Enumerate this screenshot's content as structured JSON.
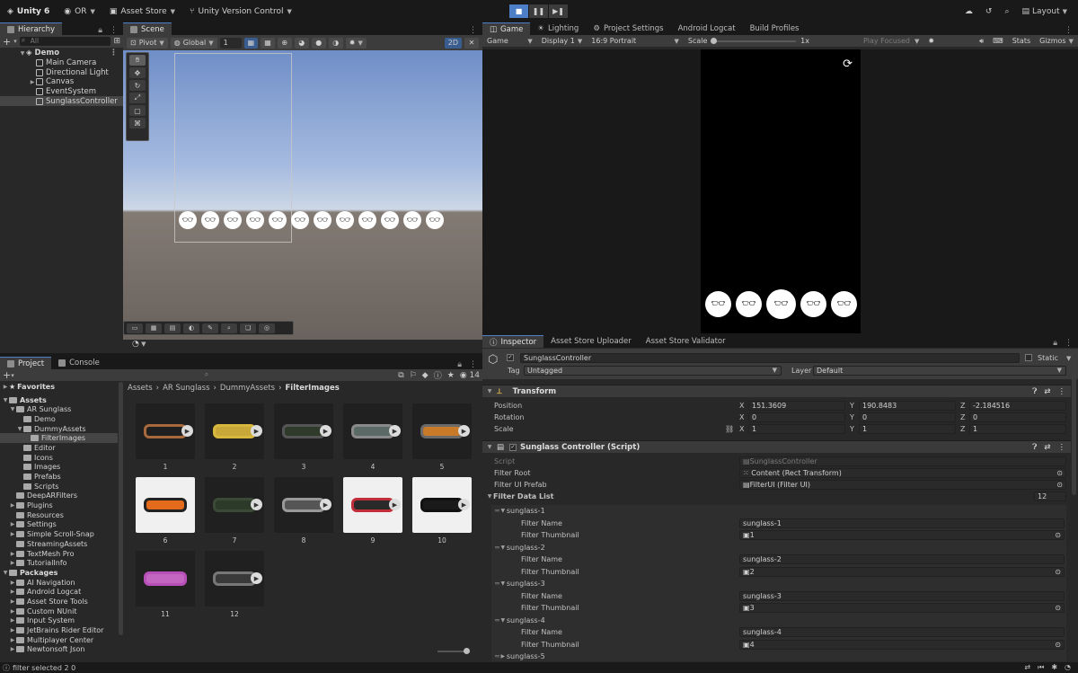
{
  "topbar": {
    "app_name": "Unity 6",
    "account": "OR",
    "asset_store": "Asset Store",
    "version_control": "Unity Version Control",
    "layout": "Layout"
  },
  "hierarchy": {
    "tab": "Hierarchy",
    "search_placeholder": "All",
    "scene_name": "Demo",
    "items": [
      "Main Camera",
      "Directional Light",
      "Canvas",
      "EventSystem",
      "SunglassController"
    ]
  },
  "scene": {
    "tab": "Scene",
    "pivot": "Pivot",
    "global": "Global",
    "grid_value": "1",
    "mode_2d": "2D"
  },
  "game": {
    "tabs": [
      "Game",
      "Lighting",
      "Project Settings",
      "Android Logcat",
      "Build Profiles"
    ],
    "mode": "Game",
    "display": "Display 1",
    "aspect": "16:9 Portrait",
    "scale_label": "Scale",
    "scale_value": "1x",
    "play_focused": "Play Focused",
    "stats": "Stats",
    "gizmos": "Gizmos"
  },
  "project": {
    "tabs": [
      "Project",
      "Console"
    ],
    "hidden_count": "14",
    "favorites": "Favorites",
    "assets_label": "Assets",
    "asset_tree": [
      {
        "label": "AR Sunglass",
        "depth": 1
      },
      {
        "label": "Demo",
        "depth": 2
      },
      {
        "label": "DummyAssets",
        "depth": 2
      },
      {
        "label": "FilterImages",
        "depth": 3
      },
      {
        "label": "Editor",
        "depth": 2
      },
      {
        "label": "Icons",
        "depth": 2
      },
      {
        "label": "Images",
        "depth": 2
      },
      {
        "label": "Prefabs",
        "depth": 2
      },
      {
        "label": "Scripts",
        "depth": 2
      },
      {
        "label": "DeepARFilters",
        "depth": 1
      },
      {
        "label": "Plugins",
        "depth": 1
      },
      {
        "label": "Resources",
        "depth": 1
      },
      {
        "label": "Settings",
        "depth": 1
      },
      {
        "label": "Simple Scroll-Snap",
        "depth": 1
      },
      {
        "label": "StreamingAssets",
        "depth": 1
      },
      {
        "label": "TextMesh Pro",
        "depth": 1
      },
      {
        "label": "TutorialInfo",
        "depth": 1
      }
    ],
    "packages_label": "Packages",
    "packages": [
      "AI Navigation",
      "Android Logcat",
      "Asset Store Tools",
      "Custom NUnit",
      "Input System",
      "JetBrains Rider Editor",
      "Multiplayer Center",
      "Newtonsoft Json"
    ],
    "breadcrumb": [
      "Assets",
      "AR Sunglass",
      "DummyAssets",
      "FilterImages"
    ],
    "assets": [
      "1",
      "2",
      "3",
      "4",
      "5",
      "6",
      "7",
      "8",
      "9",
      "10",
      "11",
      "12"
    ]
  },
  "inspector": {
    "tabs": [
      "Inspector",
      "Asset Store Uploader",
      "Asset Store Validator"
    ],
    "object_name": "SunglassController",
    "static_label": "Static",
    "tag_label": "Tag",
    "tag_value": "Untagged",
    "layer_label": "Layer",
    "layer_value": "Default",
    "transform": {
      "title": "Transform",
      "position_label": "Position",
      "rotation_label": "Rotation",
      "scale_label": "Scale",
      "position": {
        "x": "151.3609",
        "y": "190.8483",
        "z": "-2.184516"
      },
      "rotation": {
        "x": "0",
        "y": "0",
        "z": "0"
      },
      "scale": {
        "x": "1",
        "y": "1",
        "z": "1"
      }
    },
    "script_comp": {
      "title": "Sunglass Controller (Script)",
      "script_label": "Script",
      "script_value": "SunglassController",
      "filter_root_label": "Filter Root",
      "filter_root_value": "Content (Rect Transform)",
      "filter_ui_label": "Filter UI Prefab",
      "filter_ui_value": "FilterUI (Filter UI)",
      "filter_list_label": "Filter Data List",
      "filter_list_count": "12",
      "filter_name_label": "Filter Name",
      "filter_thumb_label": "Filter Thumbnail",
      "filters": [
        {
          "title": "sunglass-1",
          "name": "sunglass-1",
          "thumb": "1"
        },
        {
          "title": "sunglass-2",
          "name": "sunglass-2",
          "thumb": "2"
        },
        {
          "title": "sunglass-3",
          "name": "sunglass-3",
          "thumb": "3"
        },
        {
          "title": "sunglass-4",
          "name": "sunglass-4",
          "thumb": "4"
        }
      ],
      "next_filter": "sunglass-5"
    }
  },
  "status": {
    "text": "filter selected 2 0"
  },
  "colors": {
    "accent": "#4c7fc8",
    "panel": "#282828",
    "background": "#191919"
  }
}
